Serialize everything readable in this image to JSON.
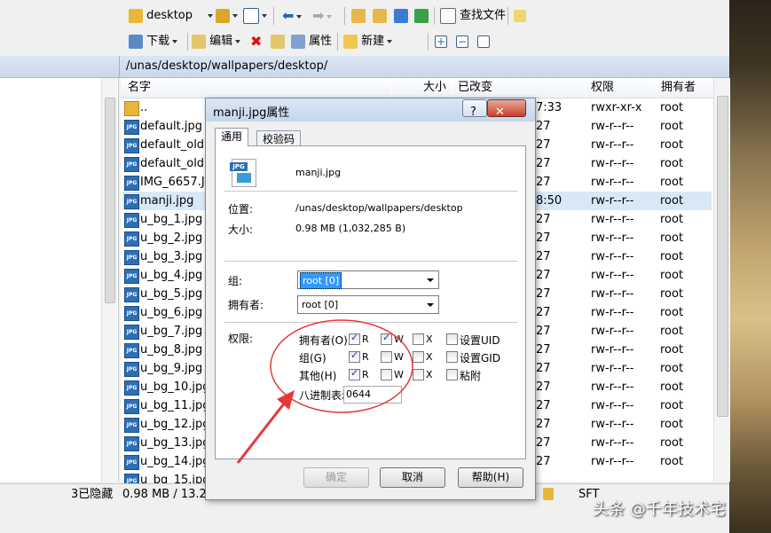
{
  "toolbar1": {
    "location": "desktop",
    "find_files": "查找文件"
  },
  "toolbar2": {
    "download": "下载",
    "edit": "编辑",
    "properties": "属性",
    "new": "新建"
  },
  "path": "/unas/desktop/wallpapers/desktop/",
  "columns": {
    "name": "名字",
    "size": "大小",
    "modified": "已改变",
    "permissions": "权限",
    "owner": "拥有者"
  },
  "files": [
    {
      "name": "..",
      "time": "7:33",
      "perm": "rwxr-xr-x",
      "owner": "root"
    },
    {
      "name": "default.jpg",
      "time": "27",
      "perm": "rw-r--r--",
      "owner": "root"
    },
    {
      "name": "default_old.jp",
      "time": "27",
      "perm": "rw-r--r--",
      "owner": "root"
    },
    {
      "name": "default_old1",
      "time": "27",
      "perm": "rw-r--r--",
      "owner": "root"
    },
    {
      "name": "IMG_6657.JP",
      "time": "27",
      "perm": "rw-r--r--",
      "owner": "root"
    },
    {
      "name": "manji.jpg",
      "time": "8:50",
      "perm": "rw-r--r--",
      "owner": "root"
    },
    {
      "name": "u_bg_1.jpg",
      "time": "27",
      "perm": "rw-r--r--",
      "owner": "root"
    },
    {
      "name": "u_bg_2.jpg",
      "time": "27",
      "perm": "rw-r--r--",
      "owner": "root"
    },
    {
      "name": "u_bg_3.jpg",
      "time": "27",
      "perm": "rw-r--r--",
      "owner": "root"
    },
    {
      "name": "u_bg_4.jpg",
      "time": "27",
      "perm": "rw-r--r--",
      "owner": "root"
    },
    {
      "name": "u_bg_5.jpg",
      "time": "27",
      "perm": "rw-r--r--",
      "owner": "root"
    },
    {
      "name": "u_bg_6.jpg",
      "time": "27",
      "perm": "rw-r--r--",
      "owner": "root"
    },
    {
      "name": "u_bg_7.jpg",
      "time": "27",
      "perm": "rw-r--r--",
      "owner": "root"
    },
    {
      "name": "u_bg_8.jpg",
      "time": "27",
      "perm": "rw-r--r--",
      "owner": "root"
    },
    {
      "name": "u_bg_9.jpg",
      "time": "27",
      "perm": "rw-r--r--",
      "owner": "root"
    },
    {
      "name": "u_bg_10.jpg",
      "time": "27",
      "perm": "rw-r--r--",
      "owner": "root"
    },
    {
      "name": "u_bg_11.jpg",
      "time": "27",
      "perm": "rw-r--r--",
      "owner": "root"
    },
    {
      "name": "u_bg_12.jpg",
      "time": "27",
      "perm": "rw-r--r--",
      "owner": "root"
    },
    {
      "name": "u_bg_13.jpg",
      "time": "27",
      "perm": "rw-r--r--",
      "owner": "root"
    },
    {
      "name": "u_bg_14.jpg",
      "time": "27",
      "perm": "rw-r--r--",
      "owner": "root"
    },
    {
      "name": "u_bg_15.jpg",
      "time": "",
      "perm": "",
      "owner": ""
    }
  ],
  "status": {
    "hidden": "3已隐藏",
    "size": "0.98 MB / 13.2 M",
    "protocol": "SFT"
  },
  "dialog": {
    "title": "manji.jpg属性",
    "help_btn": "?",
    "close_btn": "✕",
    "tab_general": "通用",
    "tab_checksum": "校验码",
    "icon_text": "JPG",
    "filename": "manji.jpg",
    "location_label": "位置:",
    "location_value": "/unas/desktop/wallpapers/desktop",
    "size_label": "大小:",
    "size_value": "0.98 MB (1,032,285 B)",
    "group_label": "组:",
    "group_value": "root [0]",
    "owner_label": "拥有者:",
    "owner_value": "root [0]",
    "perm_label": "权限:",
    "perm_owner": "拥有者(O)",
    "perm_group": "组(G)",
    "perm_other": "其他(H)",
    "r": "R",
    "w": "W",
    "x": "X",
    "setuid": "设置UID",
    "setgid": "设置GID",
    "sticky": "粘附",
    "octal_label": "八进制表示",
    "octal_value": "0644",
    "ok": "确定",
    "cancel": "取消",
    "help": "帮助(H)"
  },
  "watermark": "头条 @千年技术宅"
}
